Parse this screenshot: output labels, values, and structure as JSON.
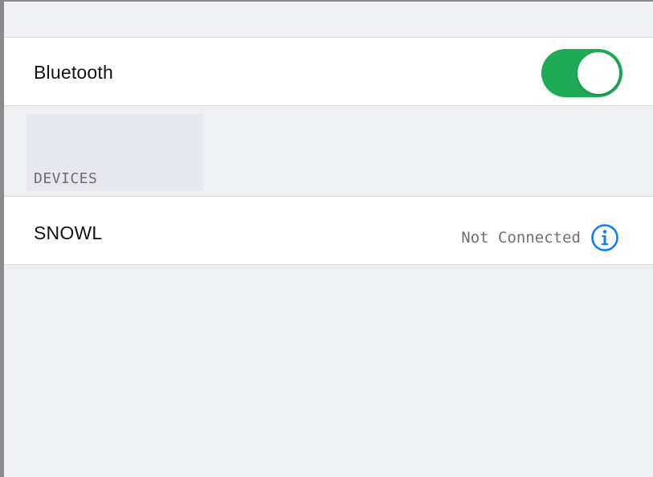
{
  "settings": {
    "bluetooth": {
      "label": "Bluetooth",
      "enabled": true,
      "toggle_color": "#1faa55"
    },
    "devices_section": {
      "header": "DEVICES",
      "items": [
        {
          "name": "SNOWL",
          "status": "Not Connected",
          "info_icon": "info-icon"
        }
      ]
    }
  },
  "colors": {
    "background": "#eff0f4",
    "row_background": "#ffffff",
    "accent_blue": "#0a7aff",
    "secondary_text": "#6d6d72"
  }
}
